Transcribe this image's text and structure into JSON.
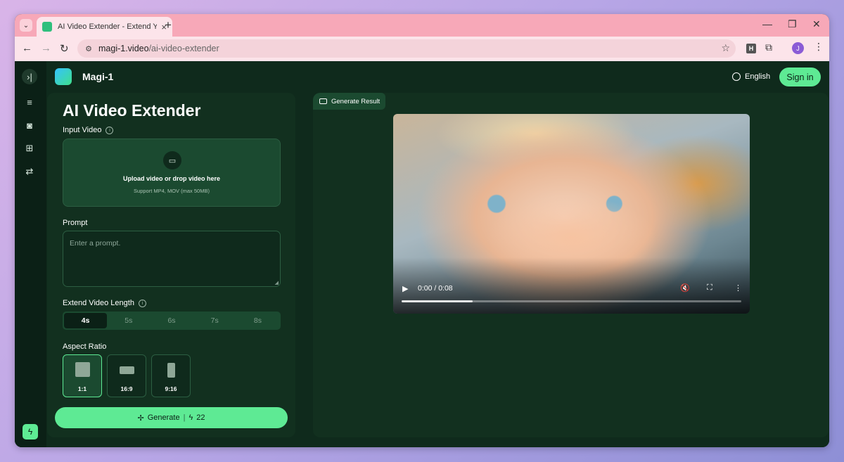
{
  "browser": {
    "tab_title": "AI Video Extender - Extend Your",
    "tab_close": "×",
    "new_tab": "+",
    "url_host": "magi-1.video",
    "url_path": "/ai-video-extender",
    "profile_initial": "J",
    "ext_label": "H",
    "window_controls": {
      "minimize": "—",
      "restore": "❐",
      "close": "✕"
    },
    "nav": {
      "back": "←",
      "forward": "→",
      "reload": "↻"
    },
    "icons": {
      "star": "☆",
      "puzzle": "⧉",
      "kebab": "⋮",
      "tab_search": "⌄",
      "site_info": "⚙"
    }
  },
  "header": {
    "brand": "Magi-1",
    "language": "English",
    "sign_in": "Sign in"
  },
  "rail": {
    "icons": [
      "collapse-icon",
      "list-icon",
      "camera-icon",
      "grid-icon",
      "swap-icon",
      "bolt-icon"
    ],
    "glyphs": {
      "collapse": "›|",
      "list": "≡",
      "camera": "◙",
      "grid": "⊞",
      "swap": "⇄",
      "bolt": "ϟ"
    }
  },
  "left_panel": {
    "title": "AI Video Extender",
    "input_video_label": "Input Video",
    "upload_title": "Upload video or drop video here",
    "upload_hint": "Support MP4, MOV (max 50MB)",
    "upload_icon_glyph": "▭",
    "prompt_label": "Prompt",
    "prompt_placeholder": "Enter a prompt.",
    "length_label": "Extend Video Length",
    "lengths": [
      "4s",
      "5s",
      "6s",
      "7s",
      "8s"
    ],
    "selected_length": "4s",
    "aspect_label": "Aspect Ratio",
    "aspects": [
      "1:1",
      "16:9",
      "9:16"
    ],
    "selected_aspect": "1:1",
    "generate_label": "Generate",
    "generate_icon": "✢",
    "credit_icon": "ϟ",
    "credits": "22",
    "info_glyph": "i"
  },
  "result": {
    "tab_label": "Generate Result",
    "time": "0:00 / 0:08",
    "progress": 0.21,
    "controls": {
      "play": "▶",
      "mute": "🔇",
      "fullscreen": "⛶",
      "more": "⋮"
    }
  },
  "colors": {
    "accent": "#5eea94",
    "page_bg": "#0f2a1c",
    "panel_bg": "#12301f",
    "tab_strip": "#f7a8b8"
  }
}
